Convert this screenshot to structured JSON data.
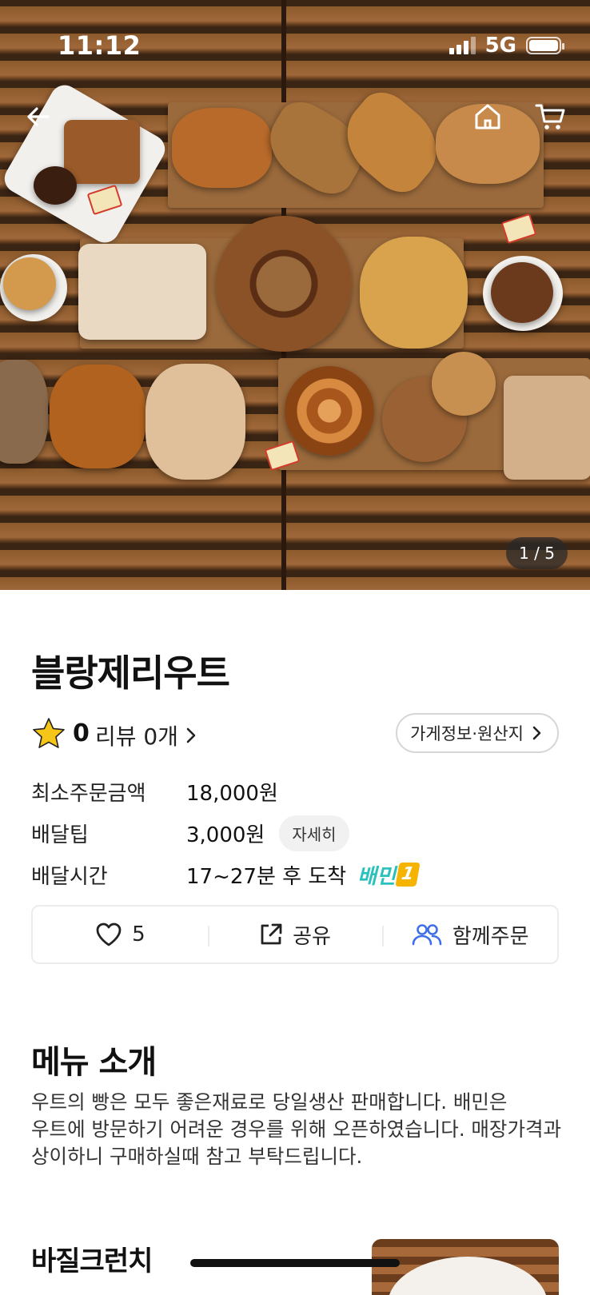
{
  "status_bar": {
    "time": "11:12",
    "network": "5G"
  },
  "hero": {
    "pager": "1 / 5"
  },
  "store": {
    "name": "블랑제리우트",
    "rating": "0",
    "review_label": "리뷰 0개",
    "info_button": "가게정보·원산지"
  },
  "info": {
    "min_order_label": "최소주문금액",
    "min_order_value": "18,000원",
    "delivery_tip_label": "배달팁",
    "delivery_tip_value": "3,000원",
    "delivery_tip_detail": "자세히",
    "delivery_time_label": "배달시간",
    "delivery_time_value": "17~27분 후 도착",
    "badge_text": "배민",
    "badge_num": "1"
  },
  "actions": {
    "like_count": "5",
    "share_label": "공유",
    "group_order_label": "함께주문"
  },
  "menu_intro": {
    "title": "메뉴 소개",
    "description": "우트의 빵은 모두 좋은재료로 당일생산 판매합니다. 배민은 우트에 방문하기 어려운 경우를 위해 오픈하였습니다. 매장가격과 상이하니 구매하실때 참고 부탁드립니다."
  },
  "menu_items": [
    {
      "name": "바질크런치"
    }
  ],
  "colors": {
    "accent_mint": "#2ac1bc",
    "group_order_blue": "#3f6fe8",
    "star": "#f5c518"
  }
}
